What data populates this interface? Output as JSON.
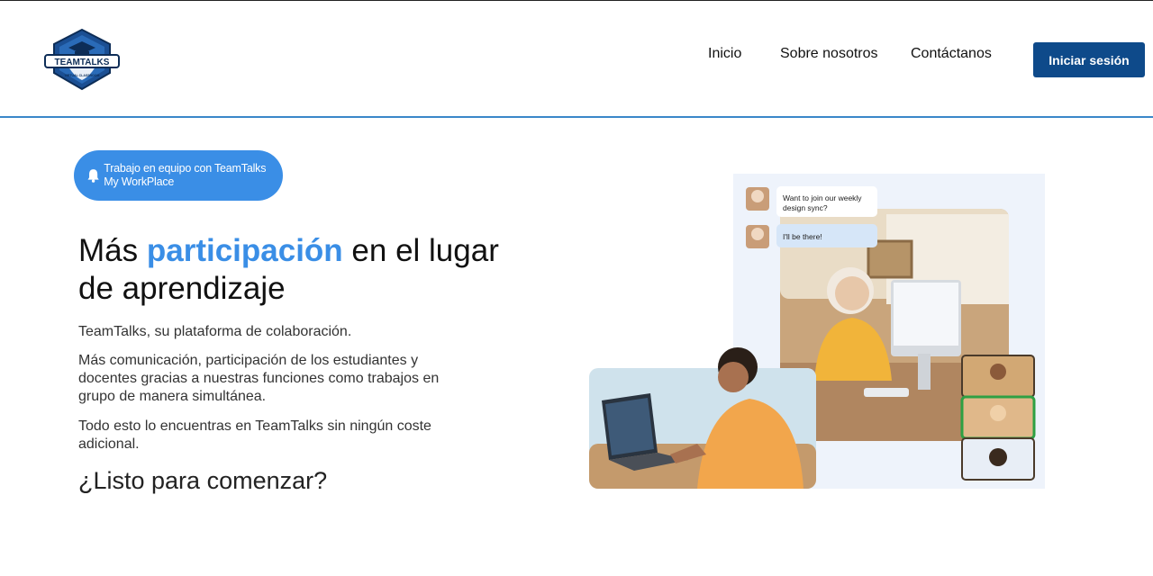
{
  "brand": {
    "logo_text": "TEAMTALKS",
    "logo_subtext": "VIRTUAL CLASSROOM"
  },
  "nav": {
    "items": [
      {
        "label": "Inicio"
      },
      {
        "label": "Sobre nosotros"
      },
      {
        "label": "Contáctanos"
      }
    ],
    "login_label": "Iniciar sesión"
  },
  "hero": {
    "pill_text": "Trabajo en equipo con TeamTalks My WorkPlace",
    "headline_before": "Más ",
    "headline_highlight": "participación",
    "headline_after": " en el lugar de aprendizaje",
    "paragraph_1": "TeamTalks, su plataforma de colaboración.",
    "paragraph_2": "Más comunicación, participación de los estudiantes y docentes gracias a nuestras funciones como trabajos en grupo de manera simultánea.",
    "paragraph_3": "Todo esto lo encuentras en TeamTalks sin ningún coste adicional.",
    "cta_text": "¿Listo para comenzar?"
  },
  "chat": {
    "message_1": "Want to join our weekly design sync?",
    "message_2": "I'll be there!"
  },
  "colors": {
    "accent": "#3a8ee6",
    "primary_button": "#0e4a8a",
    "header_border": "#3a87c9"
  }
}
